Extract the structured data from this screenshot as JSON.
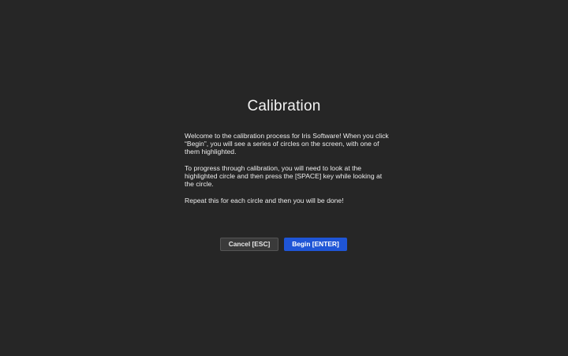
{
  "dialog": {
    "title": "Calibration",
    "paragraphs": [
      "Welcome to the calibration process for Iris Software! When you click “Begin”, you will see a series of circles on the screen, with one of them highlighted.",
      "To progress through calibration, you will need to look at the highlighted circle and then press the [SPACE] key while looking at the circle.",
      "Repeat this for each circle and then you will be done!"
    ],
    "cancel_label": "Cancel [ESC]",
    "begin_label": "Begin [ENTER]"
  },
  "colors": {
    "background": "#262626",
    "primary_button": "#1f55d6",
    "secondary_button": "#3a3a3a"
  }
}
